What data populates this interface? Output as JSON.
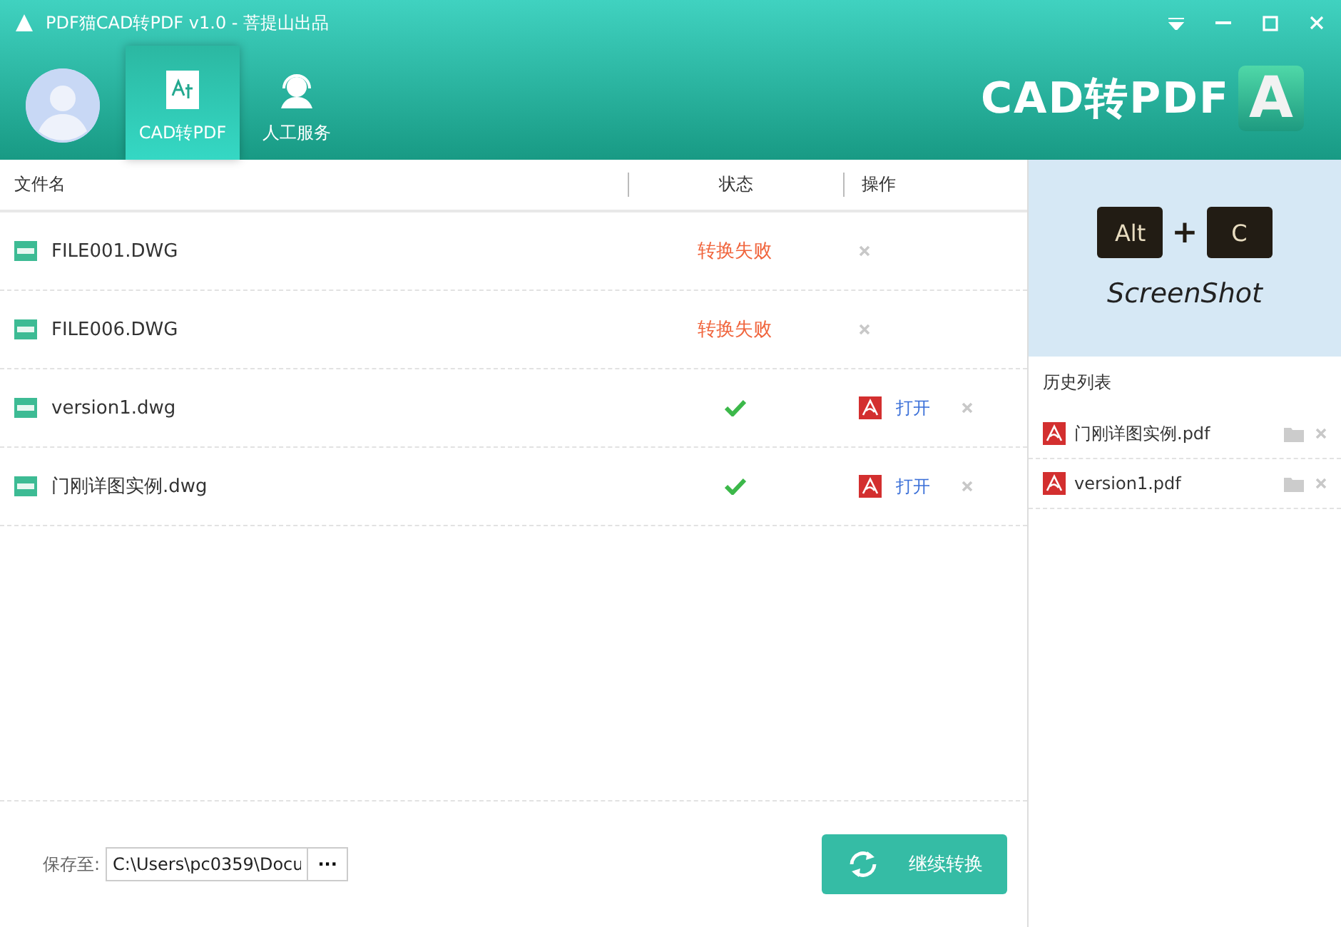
{
  "window": {
    "title": "PDF猫CAD转PDF v1.0 - 菩提山出品",
    "brand": "CAD转PDF",
    "brand_badge": "A"
  },
  "nav": [
    {
      "label": "CAD转PDF",
      "selected": true
    },
    {
      "label": "人工服务",
      "selected": false
    }
  ],
  "table": {
    "columns": [
      "文件名",
      "状态",
      "操作"
    ],
    "rows": [
      {
        "name": "FILE001.DWG",
        "status": {
          "kind": "failed",
          "text": "转换失败"
        }
      },
      {
        "name": "FILE006.DWG",
        "status": {
          "kind": "failed",
          "text": "转换失败"
        }
      },
      {
        "name": "version1.dwg",
        "status": {
          "kind": "done"
        },
        "open": "打开"
      },
      {
        "name": "门刚详图实例.dwg",
        "status": {
          "kind": "done"
        },
        "open": "打开"
      }
    ]
  },
  "footer": {
    "save_label": "保存至:",
    "save_path": "C:\\Users\\pc0359\\Docu",
    "browse": "···",
    "convert_button": "继续转换"
  },
  "banner": {
    "keys": [
      "Alt",
      "C"
    ],
    "plus": "+",
    "caption": "ScreenShot"
  },
  "history": {
    "title": "历史列表",
    "items": [
      "门刚详图实例.pdf",
      "version1.pdf"
    ]
  }
}
